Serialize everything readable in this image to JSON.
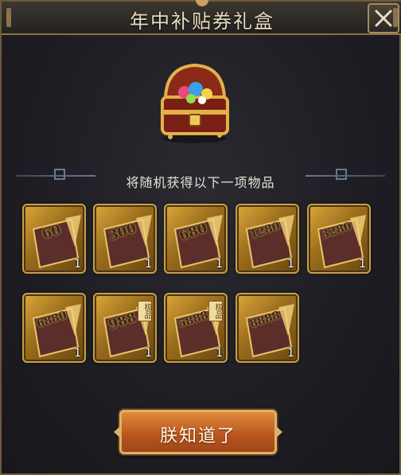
{
  "dialog": {
    "title": "年中补贴券礼盒",
    "subtitle": "将随机获得以下一项物品",
    "confirm_label": "朕知道了",
    "close_icon": "close-icon"
  },
  "chest_icon": "treasure-chest-icon",
  "items": [
    {
      "value": "60",
      "count": "1"
    },
    {
      "value": "300",
      "count": "1"
    },
    {
      "value": "680",
      "count": "1"
    },
    {
      "value": "1280",
      "count": "1"
    },
    {
      "value": "3280",
      "count": "1"
    },
    {
      "value": "6880",
      "count": "1"
    },
    {
      "value": "988",
      "count": "1",
      "badge": "极品"
    },
    {
      "value": "5888",
      "count": "1",
      "badge": "极品"
    },
    {
      "value": "8888",
      "count": "1"
    }
  ],
  "colors": {
    "accent_gold": "#c7a047",
    "button_orange": "#c0601f",
    "background": "#1e1d23"
  }
}
